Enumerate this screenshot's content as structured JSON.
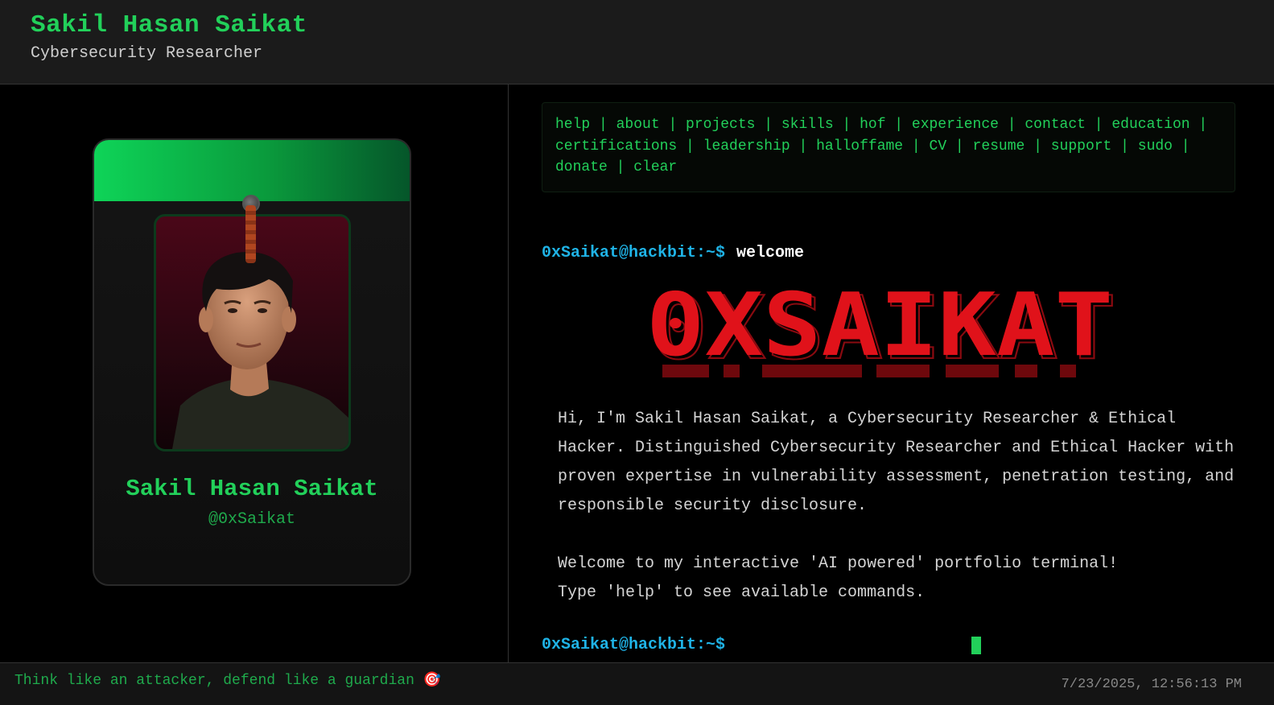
{
  "header": {
    "name": "Sakil Hasan Saikat",
    "role": "Cybersecurity Researcher"
  },
  "badge": {
    "name": "Sakil Hasan Saikat",
    "handle": "@0xSaikat",
    "photo_alt": "profile-photo"
  },
  "commands": [
    {
      "label": "help"
    },
    {
      "label": "about"
    },
    {
      "label": "projects"
    },
    {
      "label": "skills"
    },
    {
      "label": "hof"
    },
    {
      "label": "experience"
    },
    {
      "label": "contact"
    },
    {
      "label": "education"
    },
    {
      "label": "certifications"
    },
    {
      "label": "leadership"
    },
    {
      "label": "halloffame"
    },
    {
      "label": "CV"
    },
    {
      "label": "resume"
    },
    {
      "label": "support"
    },
    {
      "label": "sudo"
    },
    {
      "label": "donate"
    },
    {
      "label": "clear"
    }
  ],
  "terminal": {
    "prompt": "0xSaikat@hackbit:~$",
    "last_command": "welcome",
    "banner_text": "0XSAIKAT",
    "intro_line1": "Hi, I'm Sakil Hasan Saikat, a Cybersecurity Researcher & Ethical",
    "intro_line2": "Hacker. Distinguished Cybersecurity Researcher and Ethical Hacker with",
    "intro_line3": "proven expertise in vulnerability assessment, penetration testing, and",
    "intro_line4": "responsible security disclosure.",
    "welcome_line": "Welcome to my interactive 'AI powered' portfolio terminal!",
    "help_line": "Type 'help' to see available commands.",
    "input_value": ""
  },
  "footer": {
    "motto": "Think like an attacker, defend like a guardian 🎯",
    "datetime": "7/23/2025, 12:56:13 PM"
  },
  "colors": {
    "accent_green": "#22d05a",
    "prompt_blue": "#1fb3e6",
    "banner_red": "#e0121a"
  }
}
